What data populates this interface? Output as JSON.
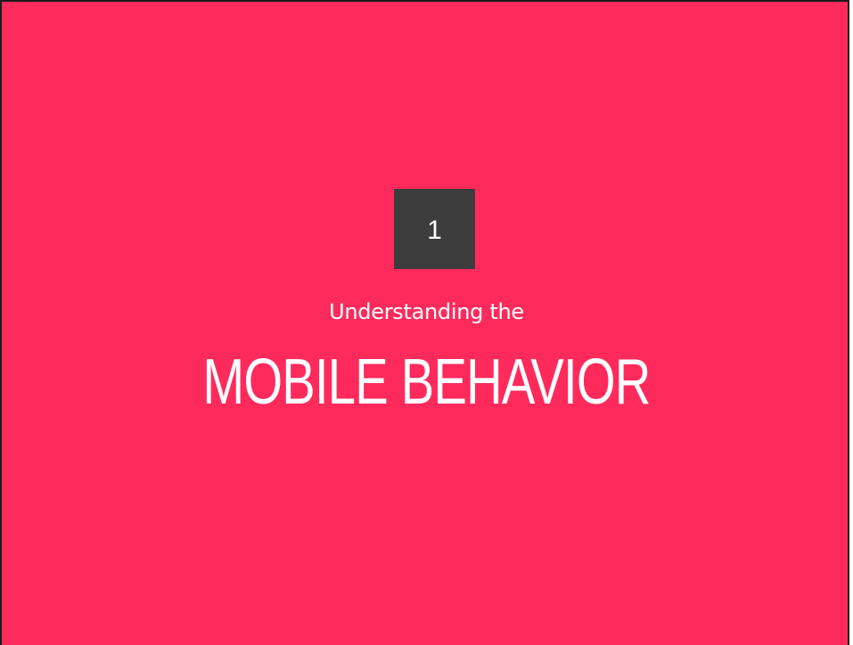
{
  "slide": {
    "number": "1",
    "subtitle": "Understanding the",
    "title": "MOBILE BEHAVIOR"
  },
  "colors": {
    "background": "#ff2a5c",
    "number_box": "#3d3d3d",
    "text": "#ffffff",
    "border": "#1a1a1a"
  }
}
